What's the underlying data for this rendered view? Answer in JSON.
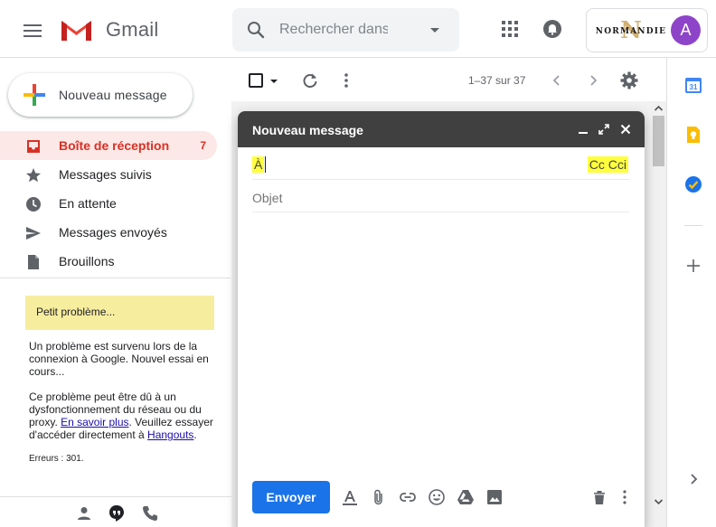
{
  "header": {
    "app_name": "Gmail",
    "search_placeholder": "Rechercher dans les messages",
    "account_logo_text": "NORMANDIE",
    "avatar_initial": "A",
    "colors": {
      "avatar": "#8e44c8",
      "gmail_red": "#ea4335"
    }
  },
  "sidebar": {
    "compose_label": "Nouveau message",
    "items": [
      {
        "label": "Boîte de réception",
        "count": "7",
        "icon": "inbox-icon",
        "active": true
      },
      {
        "label": "Messages suivis",
        "icon": "star-icon"
      },
      {
        "label": "En attente",
        "icon": "clock-icon"
      },
      {
        "label": "Messages envoyés",
        "icon": "send-icon"
      },
      {
        "label": "Brouillons",
        "icon": "draft-icon"
      }
    ],
    "hangouts_error": {
      "title": "Petit problème...",
      "paragraph1": "Un problème est survenu lors de la connexion à Google. Nouvel essai en cours...",
      "paragraph2_before": "Ce problème peut être dû à un dysfonctionnement du réseau ou du proxy. ",
      "learn_more": "En savoir plus",
      "paragraph2_middle": ". Veuillez essayer d'accéder directement à ",
      "hangouts_link": "Hangouts",
      "paragraph2_end": ".",
      "error_code": "Erreurs : 301."
    }
  },
  "toolbar": {
    "pagination": "1–37 sur 37"
  },
  "compose": {
    "title": "Nouveau message",
    "to_label": "À",
    "cc_bcc_label": "Cc Cci",
    "subject_placeholder": "Objet",
    "send_label": "Envoyer"
  }
}
